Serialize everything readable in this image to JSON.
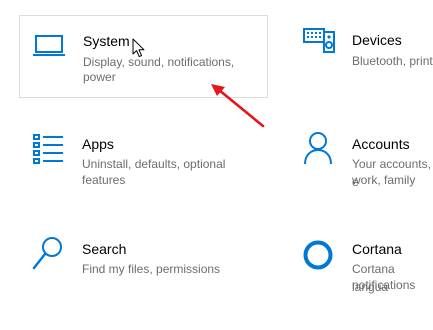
{
  "accent_color": "#0078d7",
  "annotation_color": "#e8141c",
  "tiles": [
    {
      "name": "system",
      "icon": "laptop-icon",
      "title": "System",
      "description_lines": [
        "Display, sound, notifications,",
        "power"
      ]
    },
    {
      "name": "devices",
      "icon": "keyboard-speaker-icon",
      "title": "Devices",
      "description_lines": [
        "Bluetooth, print"
      ]
    },
    {
      "name": "apps",
      "icon": "apps-list-icon",
      "title": "Apps",
      "description_lines": [
        "Uninstall, defaults, optional",
        "features"
      ]
    },
    {
      "name": "accounts",
      "icon": "person-icon",
      "title": "Accounts",
      "description_lines": [
        "Your accounts, e",
        "work, family"
      ]
    },
    {
      "name": "search",
      "icon": "search-icon",
      "title": "Search",
      "description_lines": [
        "Find my files, permissions"
      ]
    },
    {
      "name": "cortana",
      "icon": "cortana-ring-icon",
      "title": "Cortana",
      "description_lines": [
        "Cortana langua",
        "notifications"
      ]
    }
  ]
}
